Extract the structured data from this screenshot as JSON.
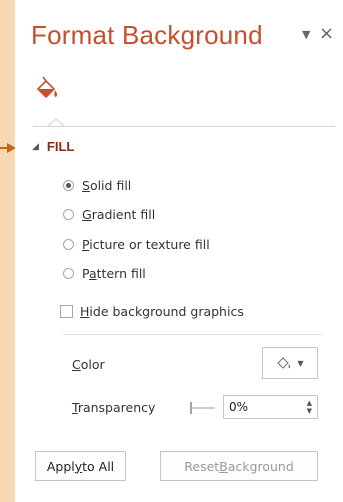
{
  "pane": {
    "title": "Format Background",
    "menu_arrow": "▼",
    "close": "×",
    "tab_icon": "paint-bucket-icon"
  },
  "section": {
    "title": "FILL",
    "collapse_glyph": "◢"
  },
  "fill_options": [
    {
      "key": "S",
      "rest": "olid fill",
      "selected": true
    },
    {
      "key": "G",
      "rest": "radient fill",
      "selected": false
    },
    {
      "key": "P",
      "rest": "icture or texture fill",
      "selected": false
    },
    {
      "pre": "P",
      "key": "a",
      "rest": "ttern fill",
      "selected": false
    }
  ],
  "hide_graphics": {
    "key": "H",
    "rest": "ide background graphics",
    "checked": false
  },
  "color": {
    "key": "C",
    "rest": "olor"
  },
  "transparency": {
    "key": "T",
    "rest": "ransparency",
    "value": "0%"
  },
  "buttons": {
    "apply": {
      "pre": "Appl",
      "key": "y",
      "rest": " to All"
    },
    "reset": {
      "pre": "Reset ",
      "key": "B",
      "rest": "ackground"
    }
  },
  "colors": {
    "accent": "#c5502f",
    "section": "#8b2a12",
    "pointer": "#c0651a",
    "background": "#f6d9b3"
  }
}
